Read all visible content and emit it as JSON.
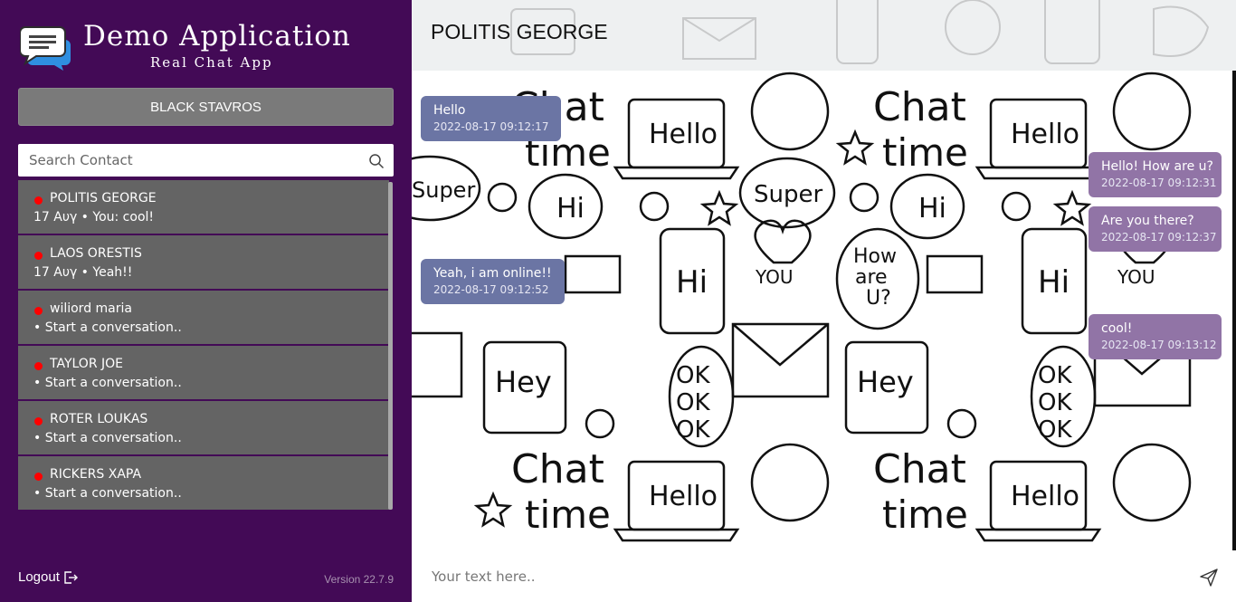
{
  "app": {
    "title": "Demo Application",
    "subtitle": "Real Chat App",
    "current_user": "BLACK STAVROS",
    "version": "Version 22.7.9",
    "logout_label": "Logout"
  },
  "search": {
    "placeholder": "Search Contact",
    "value": ""
  },
  "contacts": [
    {
      "name": "POLITIS GEORGE",
      "last": "17 Αυγ • You: cool!",
      "status_color": "#ff0000"
    },
    {
      "name": "LAOS ORESTIS",
      "last": "17 Αυγ • Yeah!!",
      "status_color": "#ff0000"
    },
    {
      "name": "wiliord maria",
      "last": "• Start a conversation..",
      "status_color": "#ff0000"
    },
    {
      "name": "TAYLOR JOE",
      "last": "• Start a conversation..",
      "status_color": "#ff0000"
    },
    {
      "name": "ROTER LOUKAS",
      "last": "• Start a conversation..",
      "status_color": "#ff0000"
    },
    {
      "name": "RICKERS XAPA",
      "last": "• Start a conversation..",
      "status_color": "#ff0000"
    }
  ],
  "chat": {
    "title": "POLITIS GEORGE",
    "messages": [
      {
        "direction": "in",
        "text": "Hello",
        "time": "2022-08-17 09:12:17"
      },
      {
        "direction": "out",
        "text": "Hello! How are u?",
        "time": "2022-08-17 09:12:31"
      },
      {
        "direction": "out",
        "text": "Are you there?",
        "time": "2022-08-17 09:12:37"
      },
      {
        "direction": "in",
        "text": "Yeah, i am online!!",
        "time": "2022-08-17 09:12:52"
      },
      {
        "direction": "out",
        "text": "cool!",
        "time": "2022-08-17 09:13:12"
      }
    ]
  },
  "composer": {
    "placeholder": "Your text here..",
    "value": ""
  },
  "colors": {
    "sidebar_bg": "#430a56",
    "contact_bg": "#646464",
    "incoming_bubble": "#6b75a4",
    "outgoing_bubble": "#9174a6",
    "status_offline": "#ff0000"
  },
  "icons": {
    "logo": "chat-bubbles-icon",
    "search": "search-icon",
    "logout": "logout-icon",
    "send": "send-icon"
  }
}
